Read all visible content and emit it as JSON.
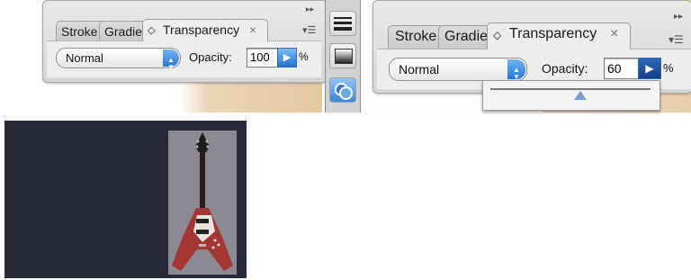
{
  "left_panel": {
    "tabs": [
      "Stroke",
      "Gradient",
      "Transparency"
    ],
    "tab_close": "×",
    "blend_mode": "Normal",
    "opacity_label": "Opacity:",
    "opacity_value": "100",
    "percent": "%",
    "collapse_glyph": "▸▸",
    "menu_glyph": "▾☰"
  },
  "right_panel": {
    "tabs": [
      "Stroke",
      "Gradient",
      "Transparency"
    ],
    "tab_close": "×",
    "blend_mode": "Normal",
    "opacity_label": "Opacity:",
    "opacity_value": "60",
    "percent": "%",
    "collapse_glyph": "▸▸",
    "menu_glyph": "▾☰",
    "slider_value": 0.6
  },
  "toolbar_icons": [
    "stroke-panel-icon",
    "gradient-panel-icon",
    "transparency-panel-icon"
  ],
  "artwork": {
    "background_color": "#272a38",
    "subject": "guitar-icon"
  }
}
